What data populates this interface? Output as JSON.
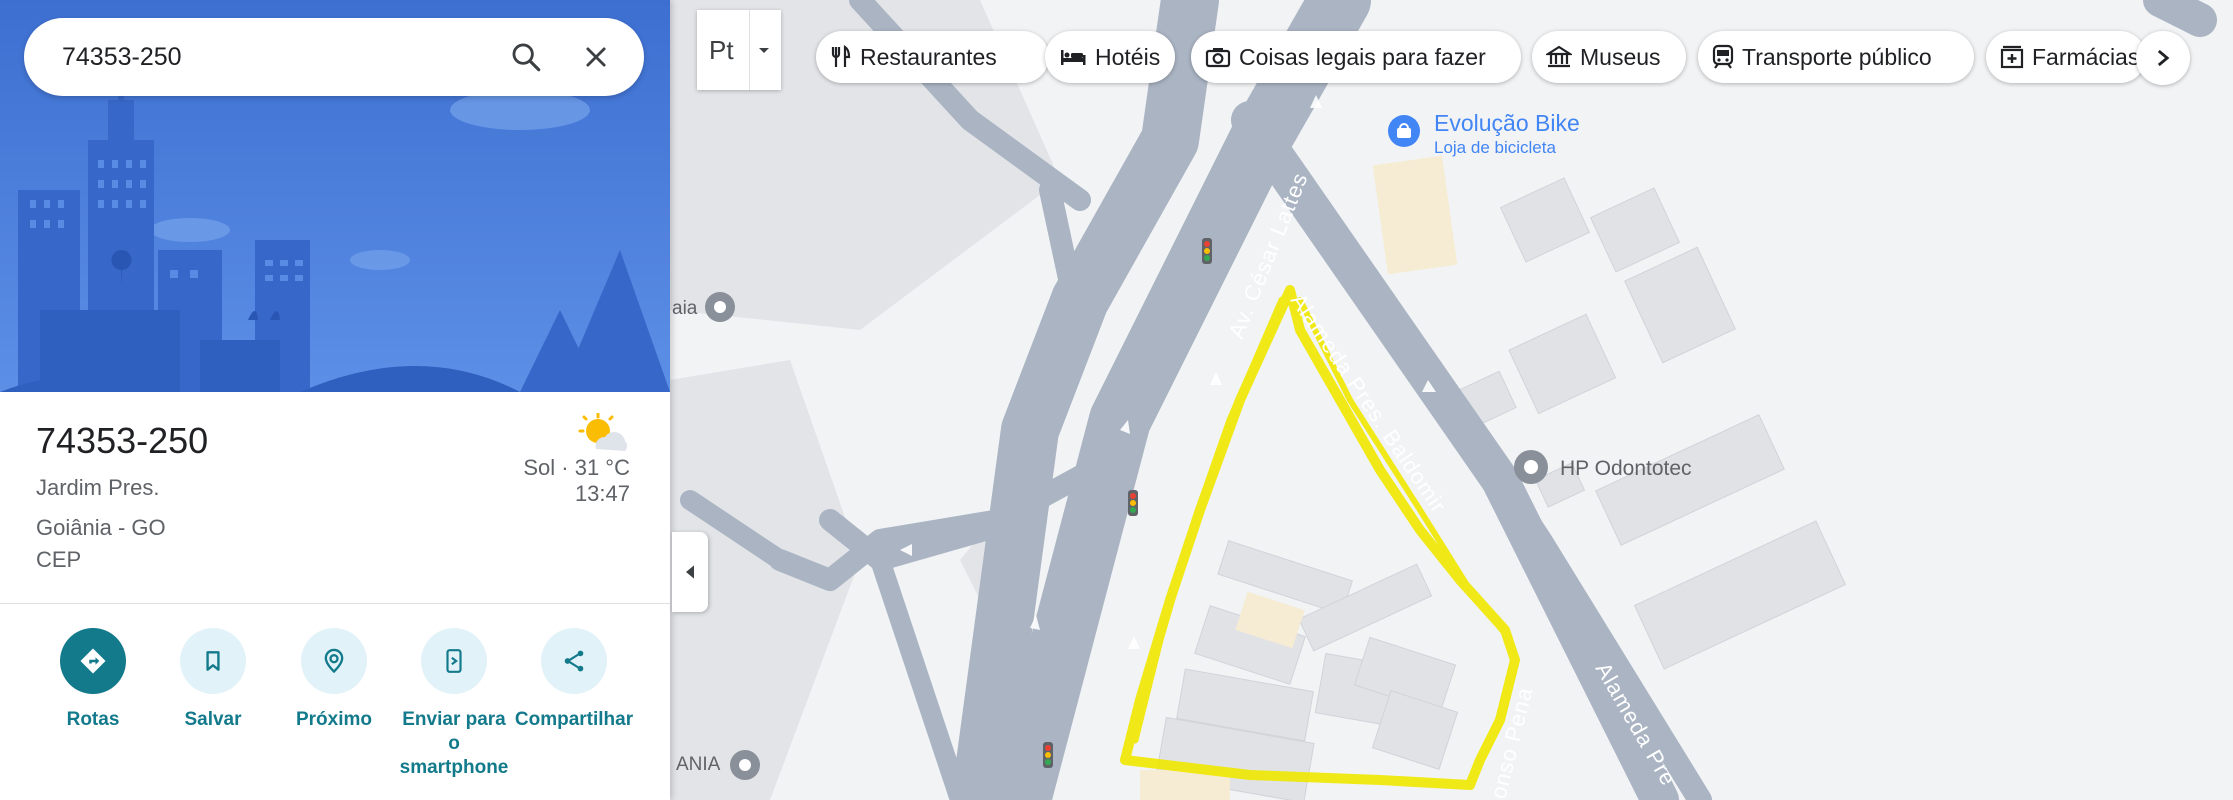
{
  "search": {
    "value": "74353-250"
  },
  "place": {
    "title": "74353-250",
    "line1": "Jardim Pres.",
    "line2": "Goiânia - GO",
    "line3": "CEP"
  },
  "weather": {
    "condition": "Sol · 31 °C",
    "time": "13:47"
  },
  "actions": [
    {
      "label": "Rotas",
      "icon": "directions-icon"
    },
    {
      "label": "Salvar",
      "icon": "bookmark-icon"
    },
    {
      "label": "Próximo",
      "icon": "nearby-icon"
    },
    {
      "label": "Enviar para o smartphone",
      "icon": "send-to-phone-icon"
    },
    {
      "label": "Compartilhar",
      "icon": "share-icon"
    }
  ],
  "layer_button": {
    "label": "Pt"
  },
  "chips": [
    {
      "label": "Restaurantes",
      "icon": "fork-knife-icon"
    },
    {
      "label": "Hotéis",
      "icon": "bed-icon"
    },
    {
      "label": "Coisas legais para fazer",
      "icon": "camera-icon"
    },
    {
      "label": "Museus",
      "icon": "museum-icon"
    },
    {
      "label": "Transporte público",
      "icon": "train-icon"
    },
    {
      "label": "Farmácias",
      "icon": "pharmacy-icon"
    }
  ],
  "map": {
    "pois": [
      {
        "name": "Evolução Bike",
        "category": "Loja de bicicleta"
      },
      {
        "name": "HP Odontotec"
      },
      {
        "name": "aia"
      },
      {
        "name": "ANIA"
      }
    ],
    "streets": [
      "Av. César Lattes",
      "Alameda Pres. Baldomir",
      "Alameda Pre",
      "onso Pena"
    ]
  },
  "colors": {
    "accent": "#137a8c",
    "highlight": "#f0e800",
    "road": "#aab4c3",
    "hero_sky": "#4f83df"
  }
}
